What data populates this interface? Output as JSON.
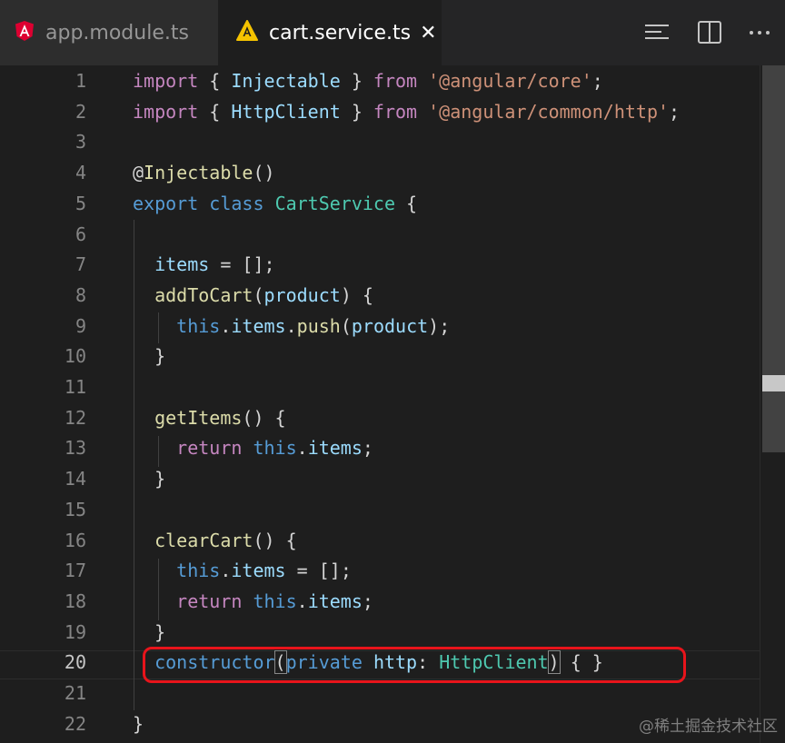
{
  "tabs": [
    {
      "label": "app.module.ts",
      "icon": "angular-icon",
      "active": false
    },
    {
      "label": "cart.service.ts",
      "icon": "angular-service-icon",
      "active": true
    }
  ],
  "actions": {
    "outline_icon": "outline-icon",
    "split_icon": "split-editor-icon",
    "more_icon": "more-actions-icon"
  },
  "editor": {
    "line_numbers": [
      "1",
      "2",
      "3",
      "4",
      "5",
      "6",
      "7",
      "8",
      "9",
      "10",
      "11",
      "12",
      "13",
      "14",
      "15",
      "16",
      "17",
      "18",
      "19",
      "20",
      "21",
      "22"
    ],
    "lines": [
      [
        [
          "kw",
          "import"
        ],
        [
          "punc",
          " { "
        ],
        [
          "var",
          "Injectable"
        ],
        [
          "punc",
          " } "
        ],
        [
          "kw",
          "from"
        ],
        [
          "punc",
          " "
        ],
        [
          "str",
          "'@angular/core'"
        ],
        [
          "punc",
          ";"
        ]
      ],
      [
        [
          "kw",
          "import"
        ],
        [
          "punc",
          " { "
        ],
        [
          "var",
          "HttpClient"
        ],
        [
          "punc",
          " } "
        ],
        [
          "kw",
          "from"
        ],
        [
          "punc",
          " "
        ],
        [
          "str",
          "'@angular/common/http'"
        ],
        [
          "punc",
          ";"
        ]
      ],
      [],
      [
        [
          "punc",
          "@"
        ],
        [
          "fn",
          "Injectable"
        ],
        [
          "punc",
          "()"
        ]
      ],
      [
        [
          "kw2",
          "export"
        ],
        [
          "punc",
          " "
        ],
        [
          "kw2",
          "class"
        ],
        [
          "punc",
          " "
        ],
        [
          "cls",
          "CartService"
        ],
        [
          "punc",
          " {"
        ]
      ],
      [],
      [
        [
          "punc",
          "  "
        ],
        [
          "var",
          "items"
        ],
        [
          "punc",
          " = [];"
        ]
      ],
      [
        [
          "punc",
          "  "
        ],
        [
          "fn",
          "addToCart"
        ],
        [
          "punc",
          "("
        ],
        [
          "var",
          "product"
        ],
        [
          "punc",
          ") {"
        ]
      ],
      [
        [
          "punc",
          "    "
        ],
        [
          "kw2",
          "this"
        ],
        [
          "punc",
          "."
        ],
        [
          "var",
          "items"
        ],
        [
          "punc",
          "."
        ],
        [
          "fn",
          "push"
        ],
        [
          "punc",
          "("
        ],
        [
          "var",
          "product"
        ],
        [
          "punc",
          ");"
        ]
      ],
      [
        [
          "punc",
          "  }"
        ]
      ],
      [],
      [
        [
          "punc",
          "  "
        ],
        [
          "fn",
          "getItems"
        ],
        [
          "punc",
          "() {"
        ]
      ],
      [
        [
          "punc",
          "    "
        ],
        [
          "kw",
          "return"
        ],
        [
          "punc",
          " "
        ],
        [
          "kw2",
          "this"
        ],
        [
          "punc",
          "."
        ],
        [
          "var",
          "items"
        ],
        [
          "punc",
          ";"
        ]
      ],
      [
        [
          "punc",
          "  }"
        ]
      ],
      [],
      [
        [
          "punc",
          "  "
        ],
        [
          "fn",
          "clearCart"
        ],
        [
          "punc",
          "() {"
        ]
      ],
      [
        [
          "punc",
          "    "
        ],
        [
          "kw2",
          "this"
        ],
        [
          "punc",
          "."
        ],
        [
          "var",
          "items"
        ],
        [
          "punc",
          " = [];"
        ]
      ],
      [
        [
          "punc",
          "    "
        ],
        [
          "kw",
          "return"
        ],
        [
          "punc",
          " "
        ],
        [
          "kw2",
          "this"
        ],
        [
          "punc",
          "."
        ],
        [
          "var",
          "items"
        ],
        [
          "punc",
          ";"
        ]
      ],
      [
        [
          "punc",
          "  }"
        ]
      ],
      [
        [
          "punc",
          "  "
        ],
        [
          "kw2",
          "constructor"
        ],
        [
          "match",
          "("
        ],
        [
          "kw2",
          "private"
        ],
        [
          "punc",
          " "
        ],
        [
          "var",
          "http"
        ],
        [
          "punc",
          ": "
        ],
        [
          "cls",
          "HttpClient"
        ],
        [
          "match",
          ")"
        ],
        [
          "punc",
          " { }"
        ]
      ],
      [],
      [
        [
          "punc",
          "}"
        ]
      ]
    ],
    "active_line": 20
  },
  "watermark": "@稀土掘金技术社区",
  "colors": {
    "highlight_box": "#e8141b",
    "angular_red": "#dd0031",
    "angular_yellow": "#f5c300"
  }
}
